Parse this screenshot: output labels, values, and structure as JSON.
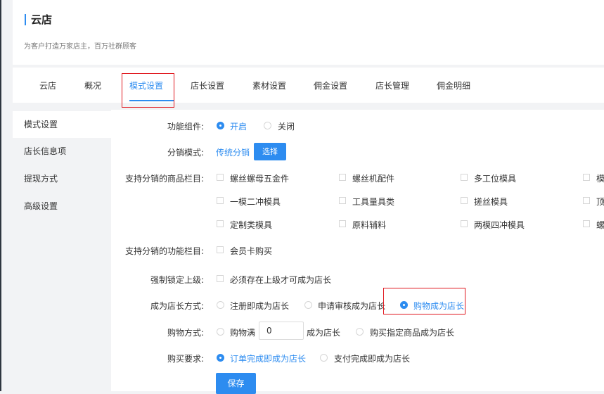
{
  "header": {
    "title": "云店",
    "subtitle": "为客户打造万家店主，百万社群顾客"
  },
  "tabs": [
    {
      "label": "云店"
    },
    {
      "label": "概况"
    },
    {
      "label": "模式设置"
    },
    {
      "label": "店长设置"
    },
    {
      "label": "素材设置"
    },
    {
      "label": "佣金设置"
    },
    {
      "label": "店长管理"
    },
    {
      "label": "佣金明细"
    }
  ],
  "sidebar": {
    "items": [
      {
        "label": "模式设置"
      },
      {
        "label": "店长信息项"
      },
      {
        "label": "提现方式"
      },
      {
        "label": "高级设置"
      }
    ]
  },
  "form": {
    "feature": {
      "label": "功能组件:",
      "options": [
        {
          "label": "开启"
        },
        {
          "label": "关闭"
        }
      ],
      "selected": "开启"
    },
    "dist_mode": {
      "label": "分销模式:",
      "value": "传统分销",
      "select_button": "选择"
    },
    "categories": {
      "label": "支持分销的商品栏目:",
      "items": [
        {
          "label": "螺丝螺母五金件"
        },
        {
          "label": "螺丝机配件"
        },
        {
          "label": "多工位模具"
        },
        {
          "label": "模"
        },
        {
          "label": "一模二冲模具"
        },
        {
          "label": "工具量具类"
        },
        {
          "label": "搓丝模具"
        },
        {
          "label": "顶"
        },
        {
          "label": "定制类模具"
        },
        {
          "label": "原料辅料"
        },
        {
          "label": "两模四冲模具"
        },
        {
          "label": "螺"
        }
      ]
    },
    "function_cols": {
      "label": "支持分销的功能栏目:",
      "items": [
        {
          "label": "会员卡购买"
        }
      ]
    },
    "lock_superior": {
      "label": "强制锁定上级:",
      "items": [
        {
          "label": "必须存在上级才可成为店长"
        }
      ]
    },
    "become_manager": {
      "label": "成为店长方式:",
      "options": [
        {
          "label": "注册即成为店长"
        },
        {
          "label": "申请审核成为店长"
        },
        {
          "label": "购物成为店长"
        }
      ],
      "selected": "购物成为店长"
    },
    "shopping": {
      "label": "购物方式:",
      "option1_prefix": "购物满",
      "amount": "0",
      "option1_suffix": "成为店长",
      "option2": "购买指定商品成为店长"
    },
    "purchase_req": {
      "label": "购买要求:",
      "options": [
        {
          "label": "订单完成即成为店长"
        },
        {
          "label": "支付完成即成为店长"
        }
      ],
      "selected": "订单完成即成为店长"
    },
    "save_button": "保存"
  },
  "colors": {
    "accent": "#2d8cf0",
    "highlight_box": "#e0171e",
    "background": "#f2f3f5"
  }
}
